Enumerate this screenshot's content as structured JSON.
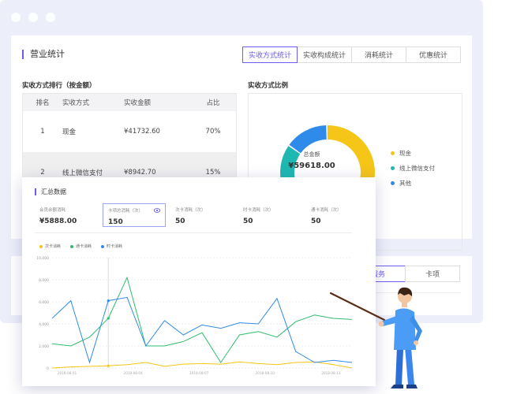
{
  "section": {
    "title": "营业统计",
    "tabs": [
      "实收方式统计",
      "实收构成统计",
      "消耗统计",
      "优惠统计"
    ],
    "active_tab": 0
  },
  "ranking": {
    "title": "实收方式排行（按金额）",
    "headers": [
      "排名",
      "实收方式",
      "实收金额",
      "占比"
    ],
    "rows": [
      [
        "1",
        "现金",
        "¥41732.60",
        "70%"
      ],
      [
        "2",
        "线上微信支付",
        "¥8942.70",
        "15%"
      ]
    ]
  },
  "ratio": {
    "title": "实收方式比例",
    "center_label": "总金额",
    "center_value": "¥59618.00",
    "legend": [
      {
        "name": "现金",
        "color": "#f5c518"
      },
      {
        "name": "线上微信支付",
        "color": "#1fb8b0"
      },
      {
        "name": "其他",
        "color": "#2f8bea"
      }
    ],
    "segments": [
      {
        "name": "现金",
        "fraction": 0.7,
        "color": "#f5c518"
      },
      {
        "name": "线上微信支付",
        "fraction": 0.15,
        "color": "#1fb8b0"
      },
      {
        "name": "其他",
        "fraction": 0.15,
        "color": "#2f8bea"
      }
    ]
  },
  "bottom_tabs": [
    "服务",
    "卡项"
  ],
  "summary": {
    "title": "汇总数据",
    "stats": [
      {
        "label": "会员余额消耗",
        "value": "¥5888.00"
      },
      {
        "label": "卡项总消耗（次）",
        "value": "150"
      },
      {
        "label": "次卡消耗（次）",
        "value": "50"
      },
      {
        "label": "时卡消耗（次）",
        "value": "50"
      },
      {
        "label": "通卡消耗（次）",
        "value": "50"
      }
    ],
    "selected_stat": 1
  },
  "chart_data": {
    "type": "line",
    "title": "",
    "xlabel": "",
    "ylabel": "",
    "y_ticks": [
      "0",
      "2,000",
      "4,000",
      "6,000",
      "8,000",
      "10,000"
    ],
    "ylim": [
      0,
      10000
    ],
    "x_ticks": [
      "2018-08-01",
      "2018-08-04",
      "2018-08-07",
      "2018-08-10",
      "2018-08-13"
    ],
    "grid": true,
    "legend_position": "top-left",
    "series": [
      {
        "name": "次卡消耗",
        "color": "#f5c518",
        "values": [
          0,
          100,
          150,
          200,
          300,
          500,
          150,
          350,
          400,
          350,
          550,
          400,
          300,
          500,
          550,
          300,
          0
        ]
      },
      {
        "name": "通卡消耗",
        "color": "#2ebd6b",
        "values": [
          2200,
          2000,
          2800,
          4500,
          8200,
          2000,
          2000,
          2400,
          3200,
          500,
          3000,
          3300,
          2800,
          4200,
          4800,
          4500,
          4400
        ]
      },
      {
        "name": "时卡消耗",
        "color": "#2f8bea",
        "values": [
          4500,
          6100,
          500,
          6100,
          6400,
          2000,
          4300,
          3000,
          3900,
          3600,
          4100,
          4000,
          6300,
          1500,
          500,
          700,
          500
        ]
      }
    ]
  }
}
